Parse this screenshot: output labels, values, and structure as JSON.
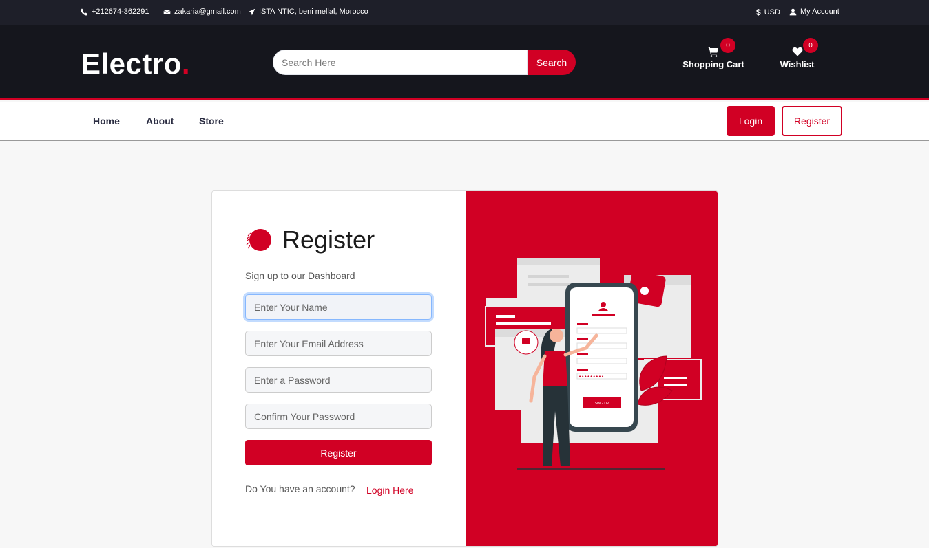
{
  "topbar": {
    "phone": "+212674-362291",
    "email": "zakaria@gmail.com",
    "address": "ISTA NTIC, beni mellal, Morocco",
    "currency": "USD",
    "account": "My Account"
  },
  "header": {
    "logo_text": "Electro",
    "logo_dot": ".",
    "search_placeholder": "Search Here",
    "search_button": "Search",
    "cart_label": "Shopping Cart",
    "cart_count": "0",
    "wishlist_label": "Wishlist",
    "wishlist_count": "0"
  },
  "nav": {
    "items": [
      {
        "label": "Home"
      },
      {
        "label": "About"
      },
      {
        "label": "Store"
      }
    ],
    "login_label": "Login",
    "register_label": "Register"
  },
  "form": {
    "title": "Register",
    "subtitle": "Sign up to our Dashboard",
    "name_placeholder": "Enter Your Name",
    "email_placeholder": "Enter Your Email Address",
    "password_placeholder": "Enter a Password",
    "confirm_placeholder": "Confirm Your Password",
    "submit_label": "Register",
    "account_question": "Do You have an account?",
    "login_link": "Login Here"
  },
  "illustration": {
    "button_text": "SING UP",
    "password_mask": "•••••••••"
  },
  "colors": {
    "accent": "#d10024",
    "topbar_bg": "#1e1f29",
    "header_bg": "#15161d"
  }
}
